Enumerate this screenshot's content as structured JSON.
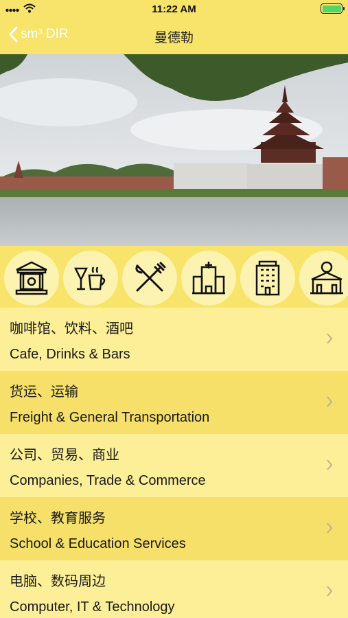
{
  "status_bar": {
    "time": "11:22 AM"
  },
  "nav": {
    "back_label": "sm³ DIR",
    "title": "曼德勒"
  },
  "categories_icons": [
    {
      "icon": "bank-icon"
    },
    {
      "icon": "drinks-icon"
    },
    {
      "icon": "restaurant-icon"
    },
    {
      "icon": "hospital-icon"
    },
    {
      "icon": "hotel-icon"
    },
    {
      "icon": "entertainment-icon"
    }
  ],
  "list": [
    {
      "cn": "咖啡馆、饮料、酒吧",
      "en": "Cafe, Drinks & Bars"
    },
    {
      "cn": "货运、运输",
      "en": "Freight & General Transportation"
    },
    {
      "cn": "公司、贸易、商业",
      "en": "Companies, Trade & Commerce"
    },
    {
      "cn": "学校、教育服务",
      "en": "School & Education Services"
    },
    {
      "cn": "电脑、数码周边",
      "en": "Computer, IT & Technology"
    }
  ],
  "colors": {
    "bar": "#f8e36b",
    "row_light": "#fcef97",
    "row_dark": "#f6e06a",
    "icon_bg": "#fdf3b0"
  }
}
